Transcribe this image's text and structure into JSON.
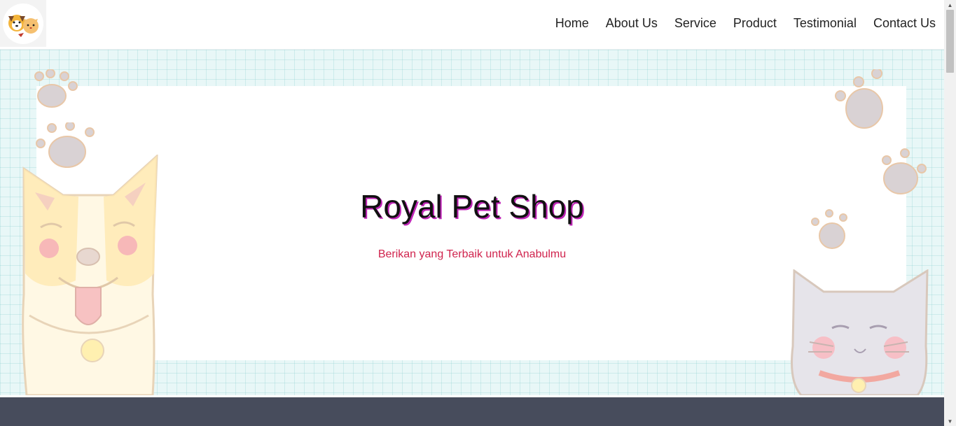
{
  "nav": {
    "items": [
      {
        "label": "Home"
      },
      {
        "label": "About Us"
      },
      {
        "label": "Service"
      },
      {
        "label": "Product"
      },
      {
        "label": "Testimonial"
      },
      {
        "label": "Contact Us"
      }
    ]
  },
  "hero": {
    "title": "Royal Pet Shop",
    "subtitle": "Berikan yang Terbaik untuk Anabulmu"
  },
  "colors": {
    "title_shadow": "#c026b8",
    "subtitle": "#d0234d",
    "hero_bg": "#e8f7f7",
    "footer_band": "#474c5c"
  },
  "icons": {
    "logo": "dog-and-cat-logo-icon",
    "scroll_up": "arrow-up-icon",
    "scroll_down": "arrow-down-icon"
  }
}
